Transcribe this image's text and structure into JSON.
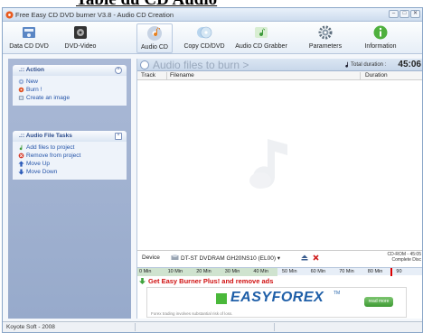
{
  "heading": {
    "text": "Table du CD Audio"
  },
  "window": {
    "title": "Free Easy CD DVD burner V3.8 - Audio CD Creation",
    "controls": {
      "minimize": "–",
      "maximize": "□",
      "close": "✕"
    }
  },
  "toolbar": {
    "items": [
      {
        "label": "Data CD DVD",
        "icon": "data-disc-icon"
      },
      {
        "label": "DVD-Video",
        "icon": "film-icon"
      },
      {
        "label": "Audio CD",
        "icon": "audio-disc-icon",
        "active": true
      },
      {
        "label": "Copy CD/DVD",
        "icon": "copy-disc-icon"
      },
      {
        "label": "Audio CD Grabber",
        "icon": "grabber-icon"
      },
      {
        "label": "Parameters",
        "icon": "gear-icon"
      },
      {
        "label": "Information",
        "icon": "info-icon"
      }
    ]
  },
  "sidebar": {
    "action_panel": {
      "title": ".:: Action",
      "items": [
        {
          "label": "New",
          "icon": "new-icon"
        },
        {
          "label": "Burn !",
          "icon": "burn-icon"
        },
        {
          "label": "Create an image",
          "icon": "image-icon"
        }
      ]
    },
    "tasks_panel": {
      "title": ".:: Audio File Tasks",
      "items": [
        {
          "label": "Add files to project",
          "icon": "add-music-icon"
        },
        {
          "label": "Remove from project",
          "icon": "remove-icon"
        },
        {
          "label": "Move Up",
          "icon": "arrow-up-icon"
        },
        {
          "label": "Move Down",
          "icon": "arrow-down-icon"
        }
      ]
    }
  },
  "main": {
    "header_title": "Audio files to burn >",
    "total_duration_label": "Total duration :",
    "total_duration_value": "45:06",
    "columns": {
      "track": "Track",
      "filename": "Filename",
      "duration": "Duration"
    }
  },
  "device": {
    "label": "Device",
    "drive": "DT-ST DVDRAM GH20NS10 (EL00)",
    "disc_info_line1": "CD-ROM - 45:05",
    "disc_info_line2": "Complete Disc"
  },
  "ruler": {
    "ticks": [
      "0 Min",
      "10 Min",
      "20 Min",
      "30 Min",
      "40 Min",
      "50 Min",
      "60 Min",
      "70 Min",
      "80 Min",
      "90"
    ],
    "used_minutes": 45.1,
    "max_minutes": 92
  },
  "promo": {
    "link_text": "Get Easy Burner Plus! and remove ads",
    "ad_brand": "EASYFOREX",
    "ad_trademark": "TM",
    "ad_button": "read more",
    "ad_disclaimer": "Forex trading involves substantial risk of loss."
  },
  "statusbar": {
    "text": "Koyote Soft - 2008"
  },
  "colors": {
    "accent": "#2353a8",
    "promo_red": "#d01010",
    "ad_green": "#4ab83a",
    "ad_blue": "#1f5fa8"
  }
}
